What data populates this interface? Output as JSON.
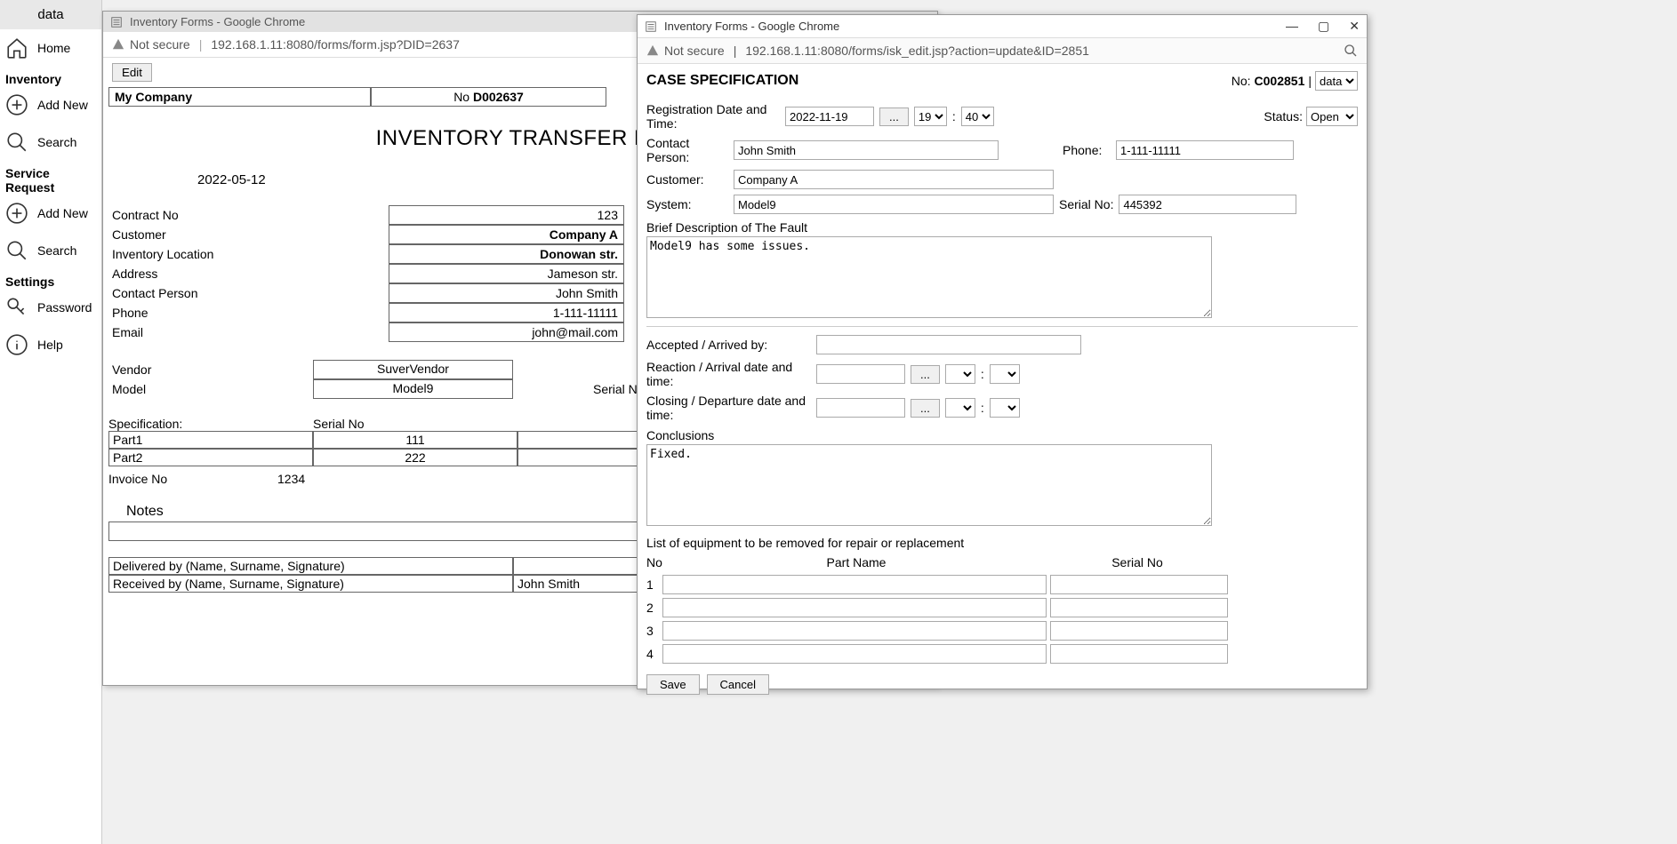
{
  "sidebar": {
    "brand": "data",
    "home": "Home",
    "sections": {
      "inventory": "Inventory",
      "service": "Service Request",
      "settings": "Settings"
    },
    "items": {
      "add_new": "Add New",
      "search": "Search",
      "password": "Password",
      "help": "Help"
    }
  },
  "win1": {
    "title": "Inventory Forms - Google Chrome",
    "security": "Not secure",
    "url": "192.168.1.11:8080/forms/form.jsp?DID=2637",
    "edit": "Edit",
    "company": "My Company",
    "docno_prefix": "No ",
    "docno": "D002637",
    "heading": "INVENTORY TRANSFER FO",
    "date": "2022-05-12",
    "fields": {
      "contract_no": {
        "label": "Contract No",
        "value": "123"
      },
      "customer": {
        "label": "Customer",
        "value": "Company A"
      },
      "inventory_location": {
        "label": "Inventory Location",
        "value": "Donowan str."
      },
      "address": {
        "label": "Address",
        "value": "Jameson str."
      },
      "contact_person": {
        "label": "Contact Person",
        "value": "John Smith"
      },
      "phone": {
        "label": "Phone",
        "value": "1-111-11111"
      },
      "email": {
        "label": "Email",
        "value": "john@mail.com"
      },
      "vendor": {
        "label": "Vendor",
        "value": "SuverVendor"
      },
      "model": {
        "label": "Model",
        "value": "Model9"
      },
      "serial": {
        "label": "Serial N"
      }
    },
    "spec": {
      "header": {
        "c1": "Specification:",
        "c2": "Serial No"
      },
      "rows": [
        {
          "c1": "Part1",
          "c2": "111"
        },
        {
          "c1": "Part2",
          "c2": "222"
        }
      ]
    },
    "invoice": {
      "label": "Invoice No",
      "value": "1234"
    },
    "notes_label": "Notes",
    "sig": {
      "delivered": "Delivered by (Name, Surname, Signature)",
      "received": "Received by (Name, Surname, Signature)",
      "received_val": "John Smith"
    }
  },
  "win2": {
    "title": "Inventory Forms - Google Chrome",
    "security": "Not secure",
    "url": "192.168.1.11:8080/forms/isk_edit.jsp?action=update&ID=2851",
    "controls": {
      "min": "—",
      "max": "▢",
      "close": "✕"
    },
    "case": {
      "title": "CASE SPECIFICATION",
      "no_label": "No:",
      "no_value": "C002851",
      "sep": "|",
      "data_sel": "data"
    },
    "labels": {
      "reg": "Registration Date and Time:",
      "status": "Status:",
      "contact": "Contact Person:",
      "phone": "Phone:",
      "customer": "Customer:",
      "system": "System:",
      "serial": "Serial No:",
      "fault": "Brief Description of The Fault",
      "accepted": "Accepted / Arrived by:",
      "reaction": "Reaction / Arrival date and time:",
      "closing": "Closing / Departure date and time:",
      "conclusions": "Conclusions",
      "equip_list": "List of equipment to be removed for repair or replacement",
      "no": "No",
      "part_name": "Part Name",
      "serial_no": "Serial No"
    },
    "values": {
      "reg_date": "2022-11-19",
      "reg_hour": "19",
      "reg_min": "40",
      "status": "Open",
      "contact": "John Smith",
      "phone": "1-111-11111",
      "customer": "Company A",
      "system": "Model9",
      "serial": "445392",
      "fault": "Model9 has some issues.",
      "accepted": "",
      "reaction_date": "",
      "closing_date": "",
      "conclusions": "Fixed."
    },
    "equip": [
      {
        "idx": "1",
        "pn": "",
        "sn": ""
      },
      {
        "idx": "2",
        "pn": "",
        "sn": ""
      },
      {
        "idx": "3",
        "pn": "",
        "sn": ""
      },
      {
        "idx": "4",
        "pn": "",
        "sn": ""
      }
    ],
    "buttons": {
      "save": "Save",
      "cancel": "Cancel",
      "dots": "..."
    }
  }
}
